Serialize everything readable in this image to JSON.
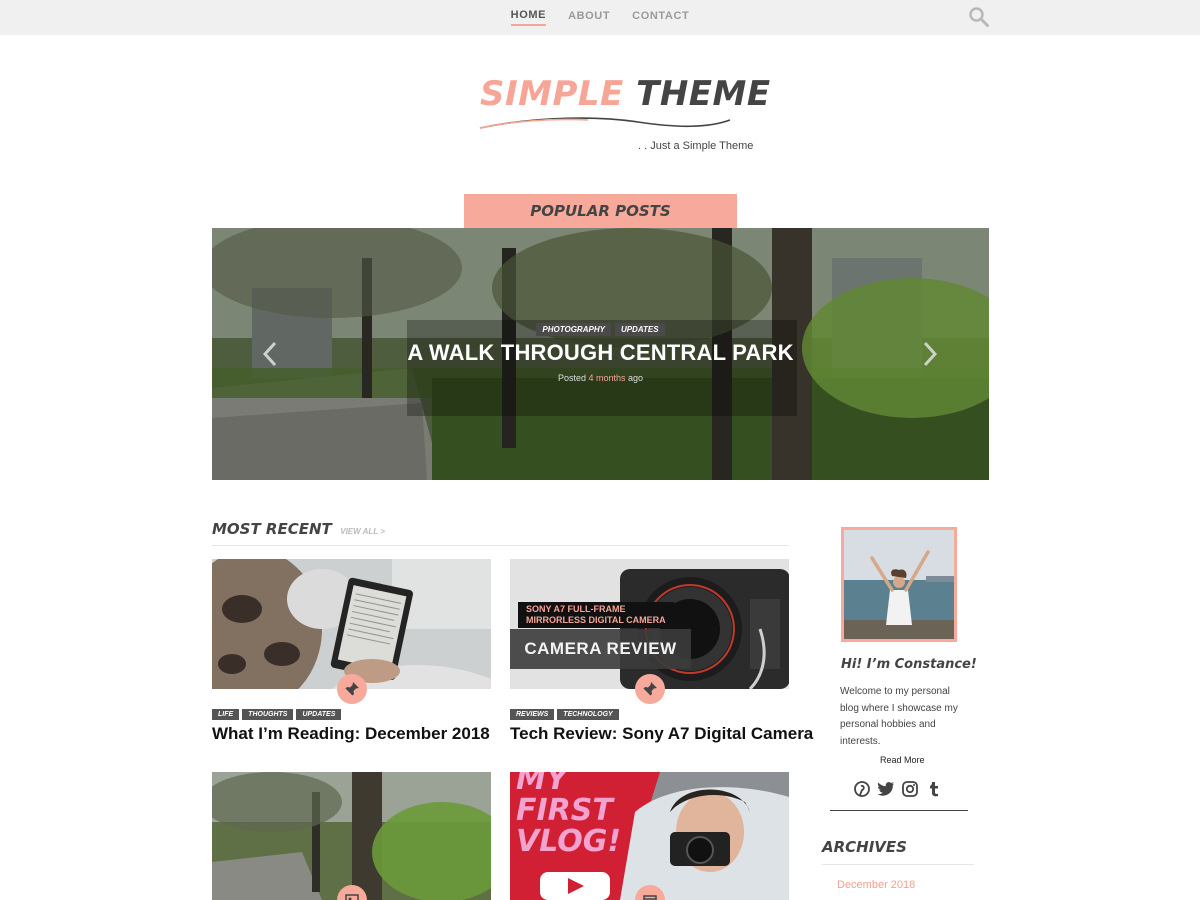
{
  "nav": {
    "items": [
      {
        "label": "HOME",
        "active": true
      },
      {
        "label": "ABOUT",
        "active": false
      },
      {
        "label": "CONTACT",
        "active": false
      }
    ],
    "search_icon": "search-icon"
  },
  "site": {
    "title_part1": "SIMPLE",
    "title_part2": "THEME",
    "tagline": ". . Just a Simple Theme",
    "accent_color": "#f7a99b"
  },
  "popular": {
    "heading": "POPULAR POSTS",
    "slide": {
      "tags": [
        "PHOTOGRAPHY",
        "UPDATES"
      ],
      "title": "A WALK THROUGH CENTRAL PARK",
      "meta_prefix": "Posted",
      "meta_time": "4 months",
      "meta_suffix": "ago"
    }
  },
  "recent": {
    "heading": "MOST RECENT",
    "view_all": "VIEW ALL >",
    "posts": [
      {
        "tags": [
          "LIFE",
          "THOUGHTS",
          "UPDATES"
        ],
        "title": "What I’m Reading: December 2018"
      },
      {
        "tags": [
          "REVIEWS",
          "TECHNOLOGY"
        ],
        "title": "Tech Review: Sony A7 Digital Camera",
        "img_caption_line1": "SONY A7 FULL-FRAME",
        "img_caption_line2": "MIRRORLESS DIGITAL CAMERA",
        "img_caption_big": "CAMERA REVIEW"
      },
      {
        "tags": [],
        "title": ""
      },
      {
        "tags": [],
        "title": "",
        "img_text_line1": "MY",
        "img_text_line2": "FIRST",
        "img_text_line3": "VLOG!"
      }
    ]
  },
  "sidebar": {
    "greeting": "Hi! I’m Constance!",
    "bio": "Welcome to my personal blog where I showcase my personal hobbies and interests.",
    "read_more": "Read More",
    "social_icons": [
      "pinterest-icon",
      "twitter-icon",
      "instagram-icon",
      "tumblr-icon"
    ],
    "archives_heading": "ARCHIVES",
    "archives": [
      "December 2018"
    ]
  }
}
